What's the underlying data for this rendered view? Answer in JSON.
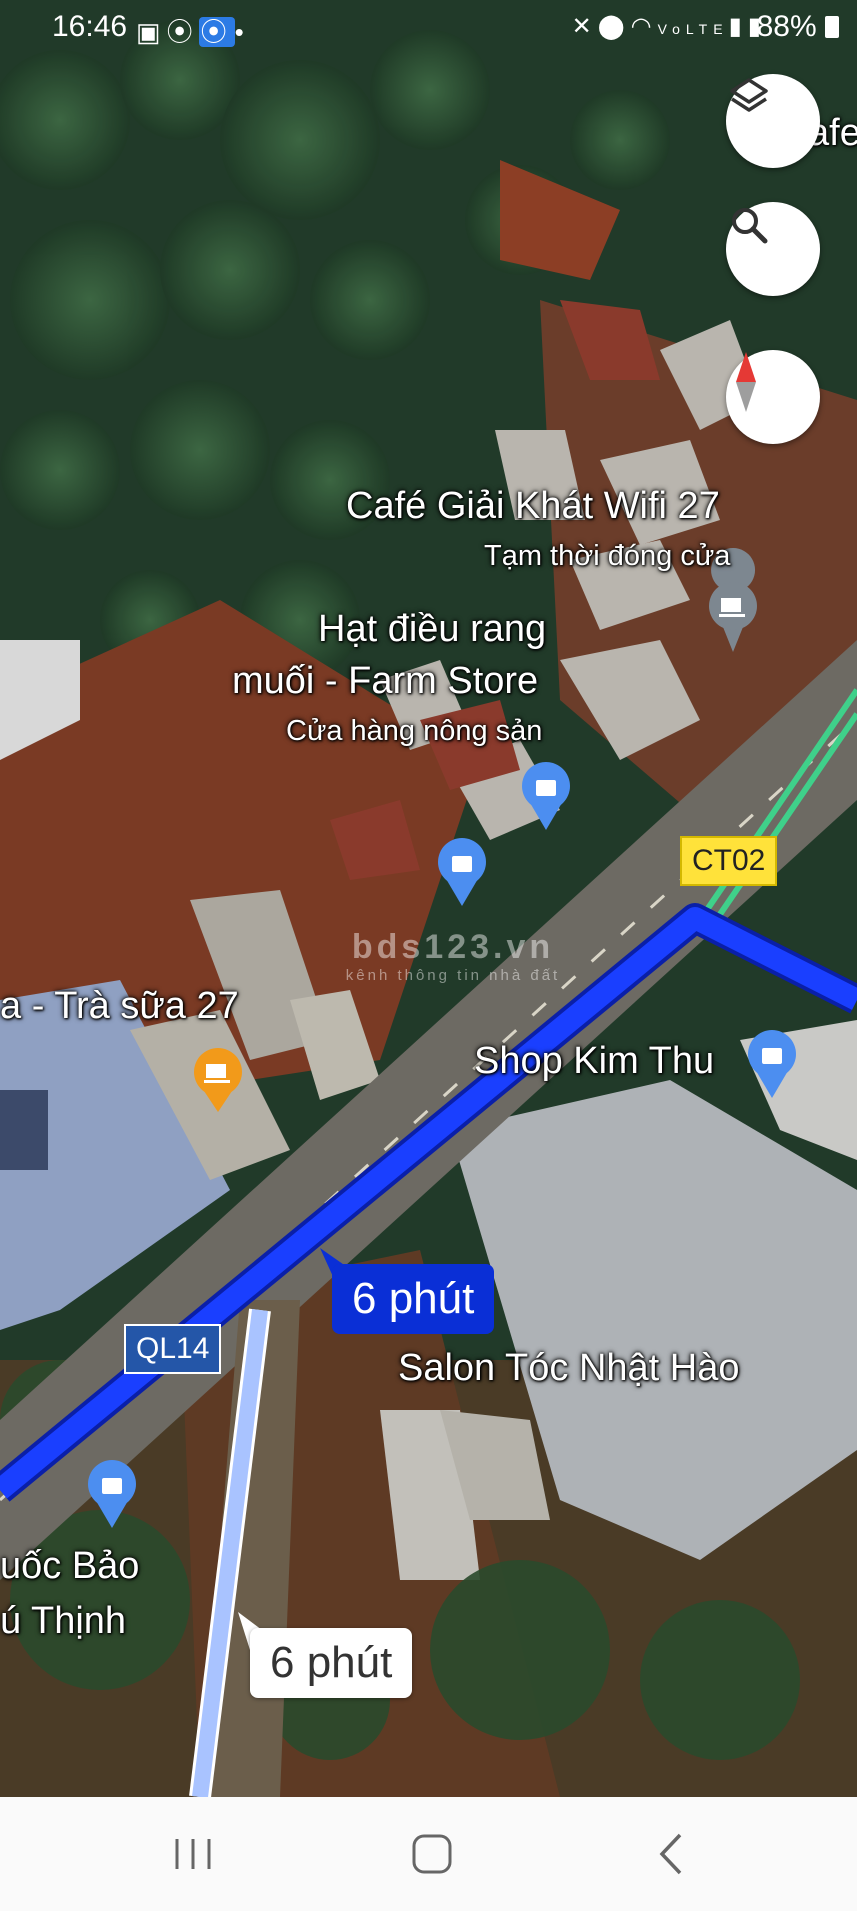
{
  "status_bar": {
    "time": "16:46",
    "battery": "88%",
    "left_icons": [
      "gallery-icon",
      "hotspot-icon",
      "wifi-calling-icon",
      "dot-icon"
    ],
    "right_icons": [
      "mute-icon",
      "location-icon",
      "wifi-icon",
      "volte-icon",
      "signal-icon",
      "signal-icon"
    ]
  },
  "map_controls": {
    "layers": "layers-icon",
    "search": "search-icon",
    "compass": "compass-icon"
  },
  "places": {
    "cafe_wifi_name": "Café Giải Khát Wifi 27",
    "cafe_wifi_status": "Tạm thời đóng cửa",
    "farm_store_line1": "Hạt điều rang",
    "farm_store_line2": "muối - Farm Store",
    "farm_store_category": "Cửa hàng nông sản",
    "tra_sua": "a - Trà sữa 27",
    "shop_kim_thu": "Shop Kim Thu",
    "salon": "Salon Tóc Nhật Hào",
    "quoc_bao_line1": "uốc Bảo",
    "quoc_bao_line2": "ú Thịnh",
    "cafe_edge": "afe"
  },
  "roads": {
    "ct02": "CT02",
    "ql14": "QL14"
  },
  "route": {
    "primary_eta": "6 phút",
    "alternate_eta": "6 phút",
    "primary_color": "#1a3fff",
    "alternate_color": "#a9c3ff"
  },
  "watermark": {
    "main": "bds123.vn",
    "sub": "kênh thông tin nhà đất"
  },
  "nav_bar": {
    "recents": "recents-icon",
    "home": "home-icon",
    "back": "back-icon"
  }
}
